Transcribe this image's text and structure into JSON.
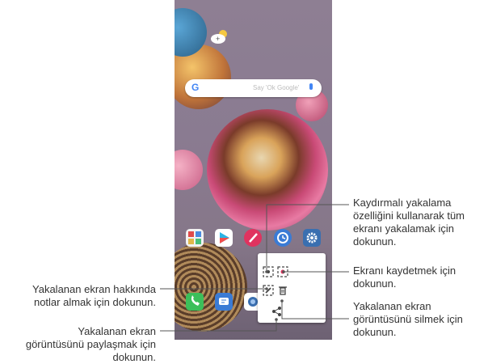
{
  "phone": {
    "search_hint": "Say 'Ok Google'",
    "search_logo": "G",
    "home_apps": [
      "gallery-folder-icon",
      "play-store-icon",
      "pen-app-icon",
      "clock-icon",
      "settings-icon"
    ],
    "dock_apps": [
      "phone-icon",
      "messages-icon",
      "camera-icon"
    ],
    "weather_icon": "weather-cloud-sun-icon"
  },
  "capture_panel": {
    "buttons": [
      "extended-capture-icon",
      "record-screen-icon",
      "edit-notes-icon",
      "delete-icon",
      "share-icon"
    ]
  },
  "callouts": {
    "extended_capture": [
      "Kaydırmalı yakalama",
      "özelliğini kullanarak tüm",
      "ekranı yakalamak için",
      "dokunun."
    ],
    "record": [
      "Ekranı kaydetmek için",
      "dokunun."
    ],
    "notes": [
      "Yakalanan ekran hakkında",
      "notlar almak için dokunun."
    ],
    "delete": [
      "Yakalanan ekran",
      "görüntüsünü silmek için",
      "dokunun."
    ],
    "share": [
      "Yakalanan ekran",
      "görüntüsünü paylaşmak için",
      "dokunun."
    ]
  },
  "colors": {
    "leader_line": "#555555",
    "phone_green": "#3cbf5a",
    "messages_blue": "#3a7bd5",
    "accent_red": "#e0335f"
  }
}
